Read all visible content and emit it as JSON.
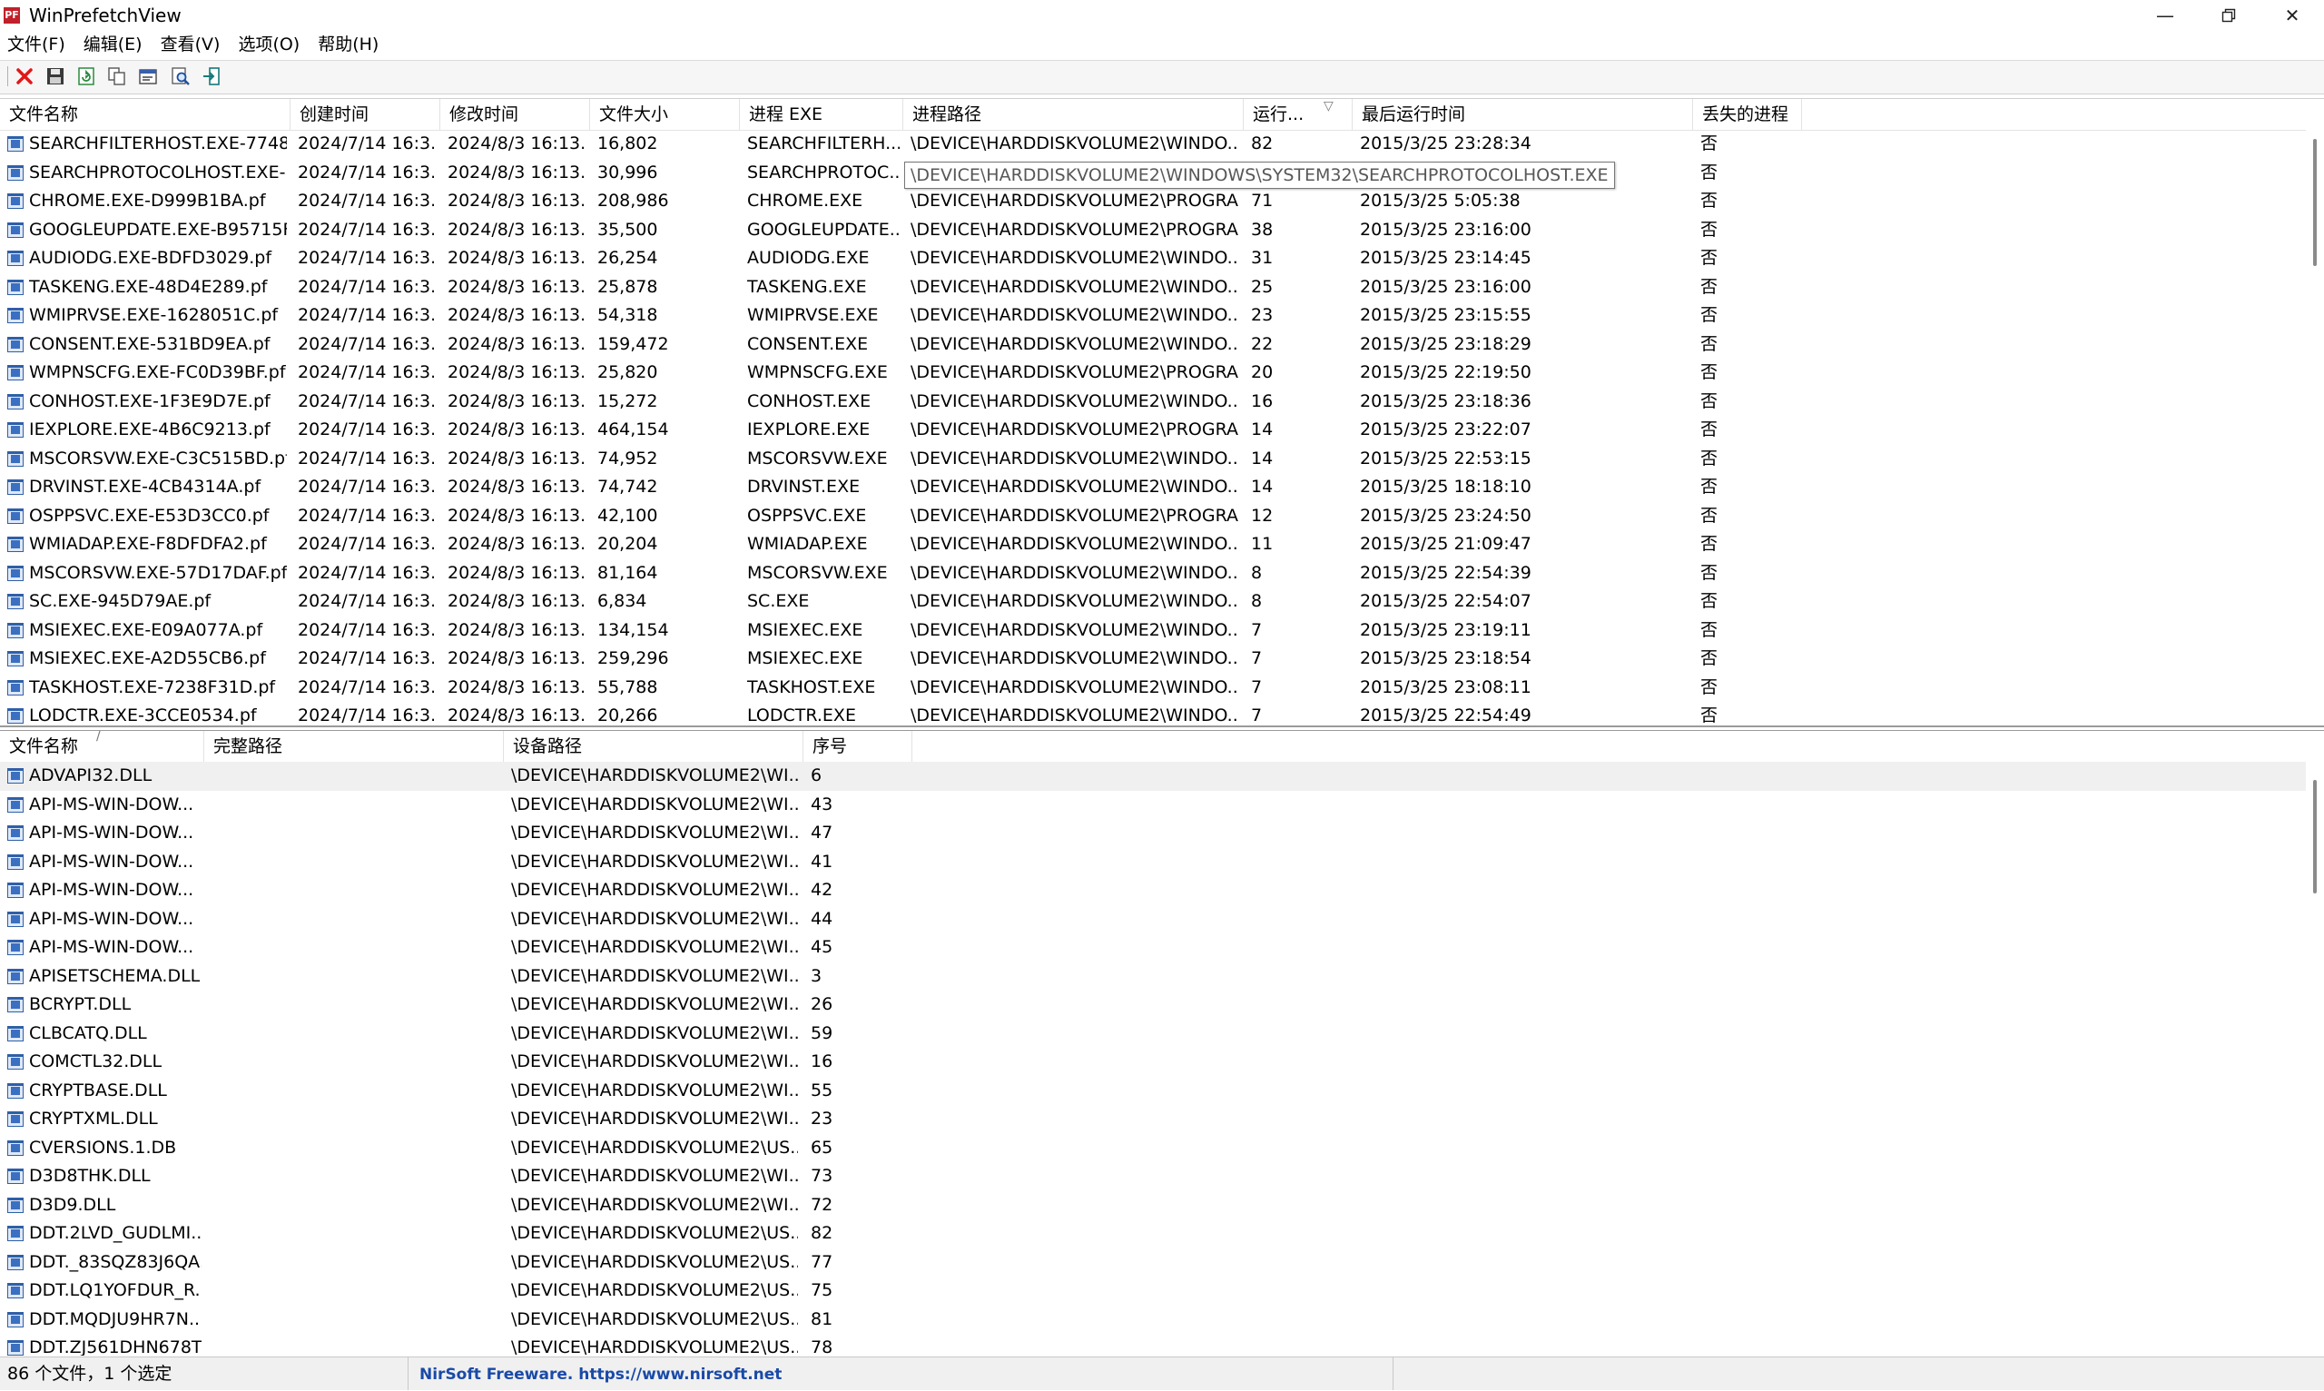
{
  "window": {
    "title": "WinPrefetchView",
    "icon_text": "PF"
  },
  "menu": [
    "文件(F)",
    "编辑(E)",
    "查看(V)",
    "选项(O)",
    "帮助(H)"
  ],
  "toolbar": {
    "buttons": [
      {
        "name": "delete-button",
        "icon": "red-x-icon"
      },
      {
        "name": "save-button",
        "icon": "floppy-disk-icon"
      },
      {
        "name": "refresh-button",
        "icon": "refresh-icon"
      },
      {
        "name": "copy-button",
        "icon": "copy-icon"
      },
      {
        "name": "properties-button",
        "icon": "properties-icon"
      },
      {
        "name": "find-button",
        "icon": "find-icon"
      },
      {
        "name": "exit-button",
        "icon": "exit-icon"
      }
    ]
  },
  "top_table": {
    "columns": [
      "文件名称",
      "创建时间",
      "修改时间",
      "文件大小",
      "进程 EXE",
      "进程路径",
      "运行...",
      "最后运行时间",
      "丢失的进程"
    ],
    "rows": [
      [
        "SEARCHFILTERHOST.EXE-7748...",
        "2024/7/14 16:3...",
        "2024/8/3 16:13...",
        "16,802",
        "SEARCHFILTERH...",
        "\\DEVICE\\HARDDISKVOLUME2\\WINDO...",
        "82",
        "2015/3/25 23:28:34",
        "否"
      ],
      [
        "SEARCHPROTOCOLHOST.EXE-...",
        "2024/7/14 16:3...",
        "2024/8/3 16:13...",
        "30,996",
        "SEARCHPROTOC...",
        "",
        "",
        "",
        "否"
      ],
      [
        "CHROME.EXE-D999B1BA.pf",
        "2024/7/14 16:3...",
        "2024/8/3 16:13...",
        "208,986",
        "CHROME.EXE",
        "\\DEVICE\\HARDDISKVOLUME2\\PROGRA...",
        "71",
        "2015/3/25 5:05:38",
        "否"
      ],
      [
        "GOOGLEUPDATE.EXE-B95715F...",
        "2024/7/14 16:3...",
        "2024/8/3 16:13...",
        "35,500",
        "GOOGLEUPDATE...",
        "\\DEVICE\\HARDDISKVOLUME2\\PROGRA...",
        "38",
        "2015/3/25 23:16:00",
        "否"
      ],
      [
        "AUDIODG.EXE-BDFD3029.pf",
        "2024/7/14 16:3...",
        "2024/8/3 16:13...",
        "26,254",
        "AUDIODG.EXE",
        "\\DEVICE\\HARDDISKVOLUME2\\WINDO...",
        "31",
        "2015/3/25 23:14:45",
        "否"
      ],
      [
        "TASKENG.EXE-48D4E289.pf",
        "2024/7/14 16:3...",
        "2024/8/3 16:13...",
        "25,878",
        "TASKENG.EXE",
        "\\DEVICE\\HARDDISKVOLUME2\\WINDO...",
        "25",
        "2015/3/25 23:16:00",
        "否"
      ],
      [
        "WMIPRVSE.EXE-1628051C.pf",
        "2024/7/14 16:3...",
        "2024/8/3 16:13...",
        "54,318",
        "WMIPRVSE.EXE",
        "\\DEVICE\\HARDDISKVOLUME2\\WINDO...",
        "23",
        "2015/3/25 23:15:55",
        "否"
      ],
      [
        "CONSENT.EXE-531BD9EA.pf",
        "2024/7/14 16:3...",
        "2024/8/3 16:13...",
        "159,472",
        "CONSENT.EXE",
        "\\DEVICE\\HARDDISKVOLUME2\\WINDO...",
        "22",
        "2015/3/25 23:18:29",
        "否"
      ],
      [
        "WMPNSCFG.EXE-FC0D39BF.pf",
        "2024/7/14 16:3...",
        "2024/8/3 16:13...",
        "25,820",
        "WMPNSCFG.EXE",
        "\\DEVICE\\HARDDISKVOLUME2\\PROGRA...",
        "20",
        "2015/3/25 22:19:50",
        "否"
      ],
      [
        "CONHOST.EXE-1F3E9D7E.pf",
        "2024/7/14 16:3...",
        "2024/8/3 16:13...",
        "15,272",
        "CONHOST.EXE",
        "\\DEVICE\\HARDDISKVOLUME2\\WINDO...",
        "16",
        "2015/3/25 23:18:36",
        "否"
      ],
      [
        "IEXPLORE.EXE-4B6C9213.pf",
        "2024/7/14 16:3...",
        "2024/8/3 16:13...",
        "464,154",
        "IEXPLORE.EXE",
        "\\DEVICE\\HARDDISKVOLUME2\\PROGRA...",
        "14",
        "2015/3/25 23:22:07",
        "否"
      ],
      [
        "MSCORSVW.EXE-C3C515BD.pf",
        "2024/7/14 16:3...",
        "2024/8/3 16:13...",
        "74,952",
        "MSCORSVW.EXE",
        "\\DEVICE\\HARDDISKVOLUME2\\WINDO...",
        "14",
        "2015/3/25 22:53:15",
        "否"
      ],
      [
        "DRVINST.EXE-4CB4314A.pf",
        "2024/7/14 16:3...",
        "2024/8/3 16:13...",
        "74,742",
        "DRVINST.EXE",
        "\\DEVICE\\HARDDISKVOLUME2\\WINDO...",
        "14",
        "2015/3/25 18:18:10",
        "否"
      ],
      [
        "OSPPSVC.EXE-E53D3CC0.pf",
        "2024/7/14 16:3...",
        "2024/8/3 16:13...",
        "42,100",
        "OSPPSVC.EXE",
        "\\DEVICE\\HARDDISKVOLUME2\\PROGRA...",
        "12",
        "2015/3/25 23:24:50",
        "否"
      ],
      [
        "WMIADAP.EXE-F8DFDFA2.pf",
        "2024/7/14 16:3...",
        "2024/8/3 16:13...",
        "20,204",
        "WMIADAP.EXE",
        "\\DEVICE\\HARDDISKVOLUME2\\WINDO...",
        "11",
        "2015/3/25 21:09:47",
        "否"
      ],
      [
        "MSCORSVW.EXE-57D17DAF.pf",
        "2024/7/14 16:3...",
        "2024/8/3 16:13...",
        "81,164",
        "MSCORSVW.EXE",
        "\\DEVICE\\HARDDISKVOLUME2\\WINDO...",
        "8",
        "2015/3/25 22:54:39",
        "否"
      ],
      [
        "SC.EXE-945D79AE.pf",
        "2024/7/14 16:3...",
        "2024/8/3 16:13...",
        "6,834",
        "SC.EXE",
        "\\DEVICE\\HARDDISKVOLUME2\\WINDO...",
        "8",
        "2015/3/25 22:54:07",
        "否"
      ],
      [
        "MSIEXEC.EXE-E09A077A.pf",
        "2024/7/14 16:3...",
        "2024/8/3 16:13...",
        "134,154",
        "MSIEXEC.EXE",
        "\\DEVICE\\HARDDISKVOLUME2\\WINDO...",
        "7",
        "2015/3/25 23:19:11",
        "否"
      ],
      [
        "MSIEXEC.EXE-A2D55CB6.pf",
        "2024/7/14 16:3...",
        "2024/8/3 16:13...",
        "259,296",
        "MSIEXEC.EXE",
        "\\DEVICE\\HARDDISKVOLUME2\\WINDO...",
        "7",
        "2015/3/25 23:18:54",
        "否"
      ],
      [
        "TASKHOST.EXE-7238F31D.pf",
        "2024/7/14 16:3...",
        "2024/8/3 16:13...",
        "55,788",
        "TASKHOST.EXE",
        "\\DEVICE\\HARDDISKVOLUME2\\WINDO...",
        "7",
        "2015/3/25 23:08:11",
        "否"
      ],
      [
        "LODCTR.EXE-3CCE0534.pf",
        "2024/7/14 16:3...",
        "2024/8/3 16:13...",
        "20,266",
        "LODCTR.EXE",
        "\\DEVICE\\HARDDISKVOLUME2\\WINDO...",
        "7",
        "2015/3/25 22:54:49",
        "否"
      ]
    ]
  },
  "tooltip": "\\DEVICE\\HARDDISKVOLUME2\\WINDOWS\\SYSTEM32\\SEARCHPROTOCOLHOST.EXE",
  "bottom_table": {
    "columns": [
      "文件名称",
      "完整路径",
      "设备路径",
      "序号"
    ],
    "rows": [
      [
        "ADVAPI32.DLL",
        "",
        "\\DEVICE\\HARDDISKVOLUME2\\WI...",
        "6"
      ],
      [
        "API-MS-WIN-DOW...",
        "",
        "\\DEVICE\\HARDDISKVOLUME2\\WI...",
        "43"
      ],
      [
        "API-MS-WIN-DOW...",
        "",
        "\\DEVICE\\HARDDISKVOLUME2\\WI...",
        "47"
      ],
      [
        "API-MS-WIN-DOW...",
        "",
        "\\DEVICE\\HARDDISKVOLUME2\\WI...",
        "41"
      ],
      [
        "API-MS-WIN-DOW...",
        "",
        "\\DEVICE\\HARDDISKVOLUME2\\WI...",
        "42"
      ],
      [
        "API-MS-WIN-DOW...",
        "",
        "\\DEVICE\\HARDDISKVOLUME2\\WI...",
        "44"
      ],
      [
        "API-MS-WIN-DOW...",
        "",
        "\\DEVICE\\HARDDISKVOLUME2\\WI...",
        "45"
      ],
      [
        "APISETSCHEMA.DLL",
        "",
        "\\DEVICE\\HARDDISKVOLUME2\\WI...",
        "3"
      ],
      [
        "BCRYPT.DLL",
        "",
        "\\DEVICE\\HARDDISKVOLUME2\\WI...",
        "26"
      ],
      [
        "CLBCATQ.DLL",
        "",
        "\\DEVICE\\HARDDISKVOLUME2\\WI...",
        "59"
      ],
      [
        "COMCTL32.DLL",
        "",
        "\\DEVICE\\HARDDISKVOLUME2\\WI...",
        "16"
      ],
      [
        "CRYPTBASE.DLL",
        "",
        "\\DEVICE\\HARDDISKVOLUME2\\WI...",
        "55"
      ],
      [
        "CRYPTXML.DLL",
        "",
        "\\DEVICE\\HARDDISKVOLUME2\\WI...",
        "23"
      ],
      [
        "CVERSIONS.1.DB",
        "",
        "\\DEVICE\\HARDDISKVOLUME2\\US...",
        "65"
      ],
      [
        "D3D8THK.DLL",
        "",
        "\\DEVICE\\HARDDISKVOLUME2\\WI...",
        "73"
      ],
      [
        "D3D9.DLL",
        "",
        "\\DEVICE\\HARDDISKVOLUME2\\WI...",
        "72"
      ],
      [
        "DDT.2LVD_GUDLMI...",
        "",
        "\\DEVICE\\HARDDISKVOLUME2\\US...",
        "82"
      ],
      [
        "DDT._83SQZ83J6QA...",
        "",
        "\\DEVICE\\HARDDISKVOLUME2\\US...",
        "77"
      ],
      [
        "DDT.LQ1YOFDUR_R...",
        "",
        "\\DEVICE\\HARDDISKVOLUME2\\US...",
        "75"
      ],
      [
        "DDT.MQDJU9HR7N...",
        "",
        "\\DEVICE\\HARDDISKVOLUME2\\US...",
        "81"
      ],
      [
        "DDT.ZJ561DHN678T...",
        "",
        "\\DEVICE\\HARDDISKVOLUME2\\US...",
        "78"
      ]
    ]
  },
  "status": {
    "count_text": "86 个文件，1 个选定",
    "link_text": "NirSoft Freeware. https://www.nirsoft.net"
  }
}
